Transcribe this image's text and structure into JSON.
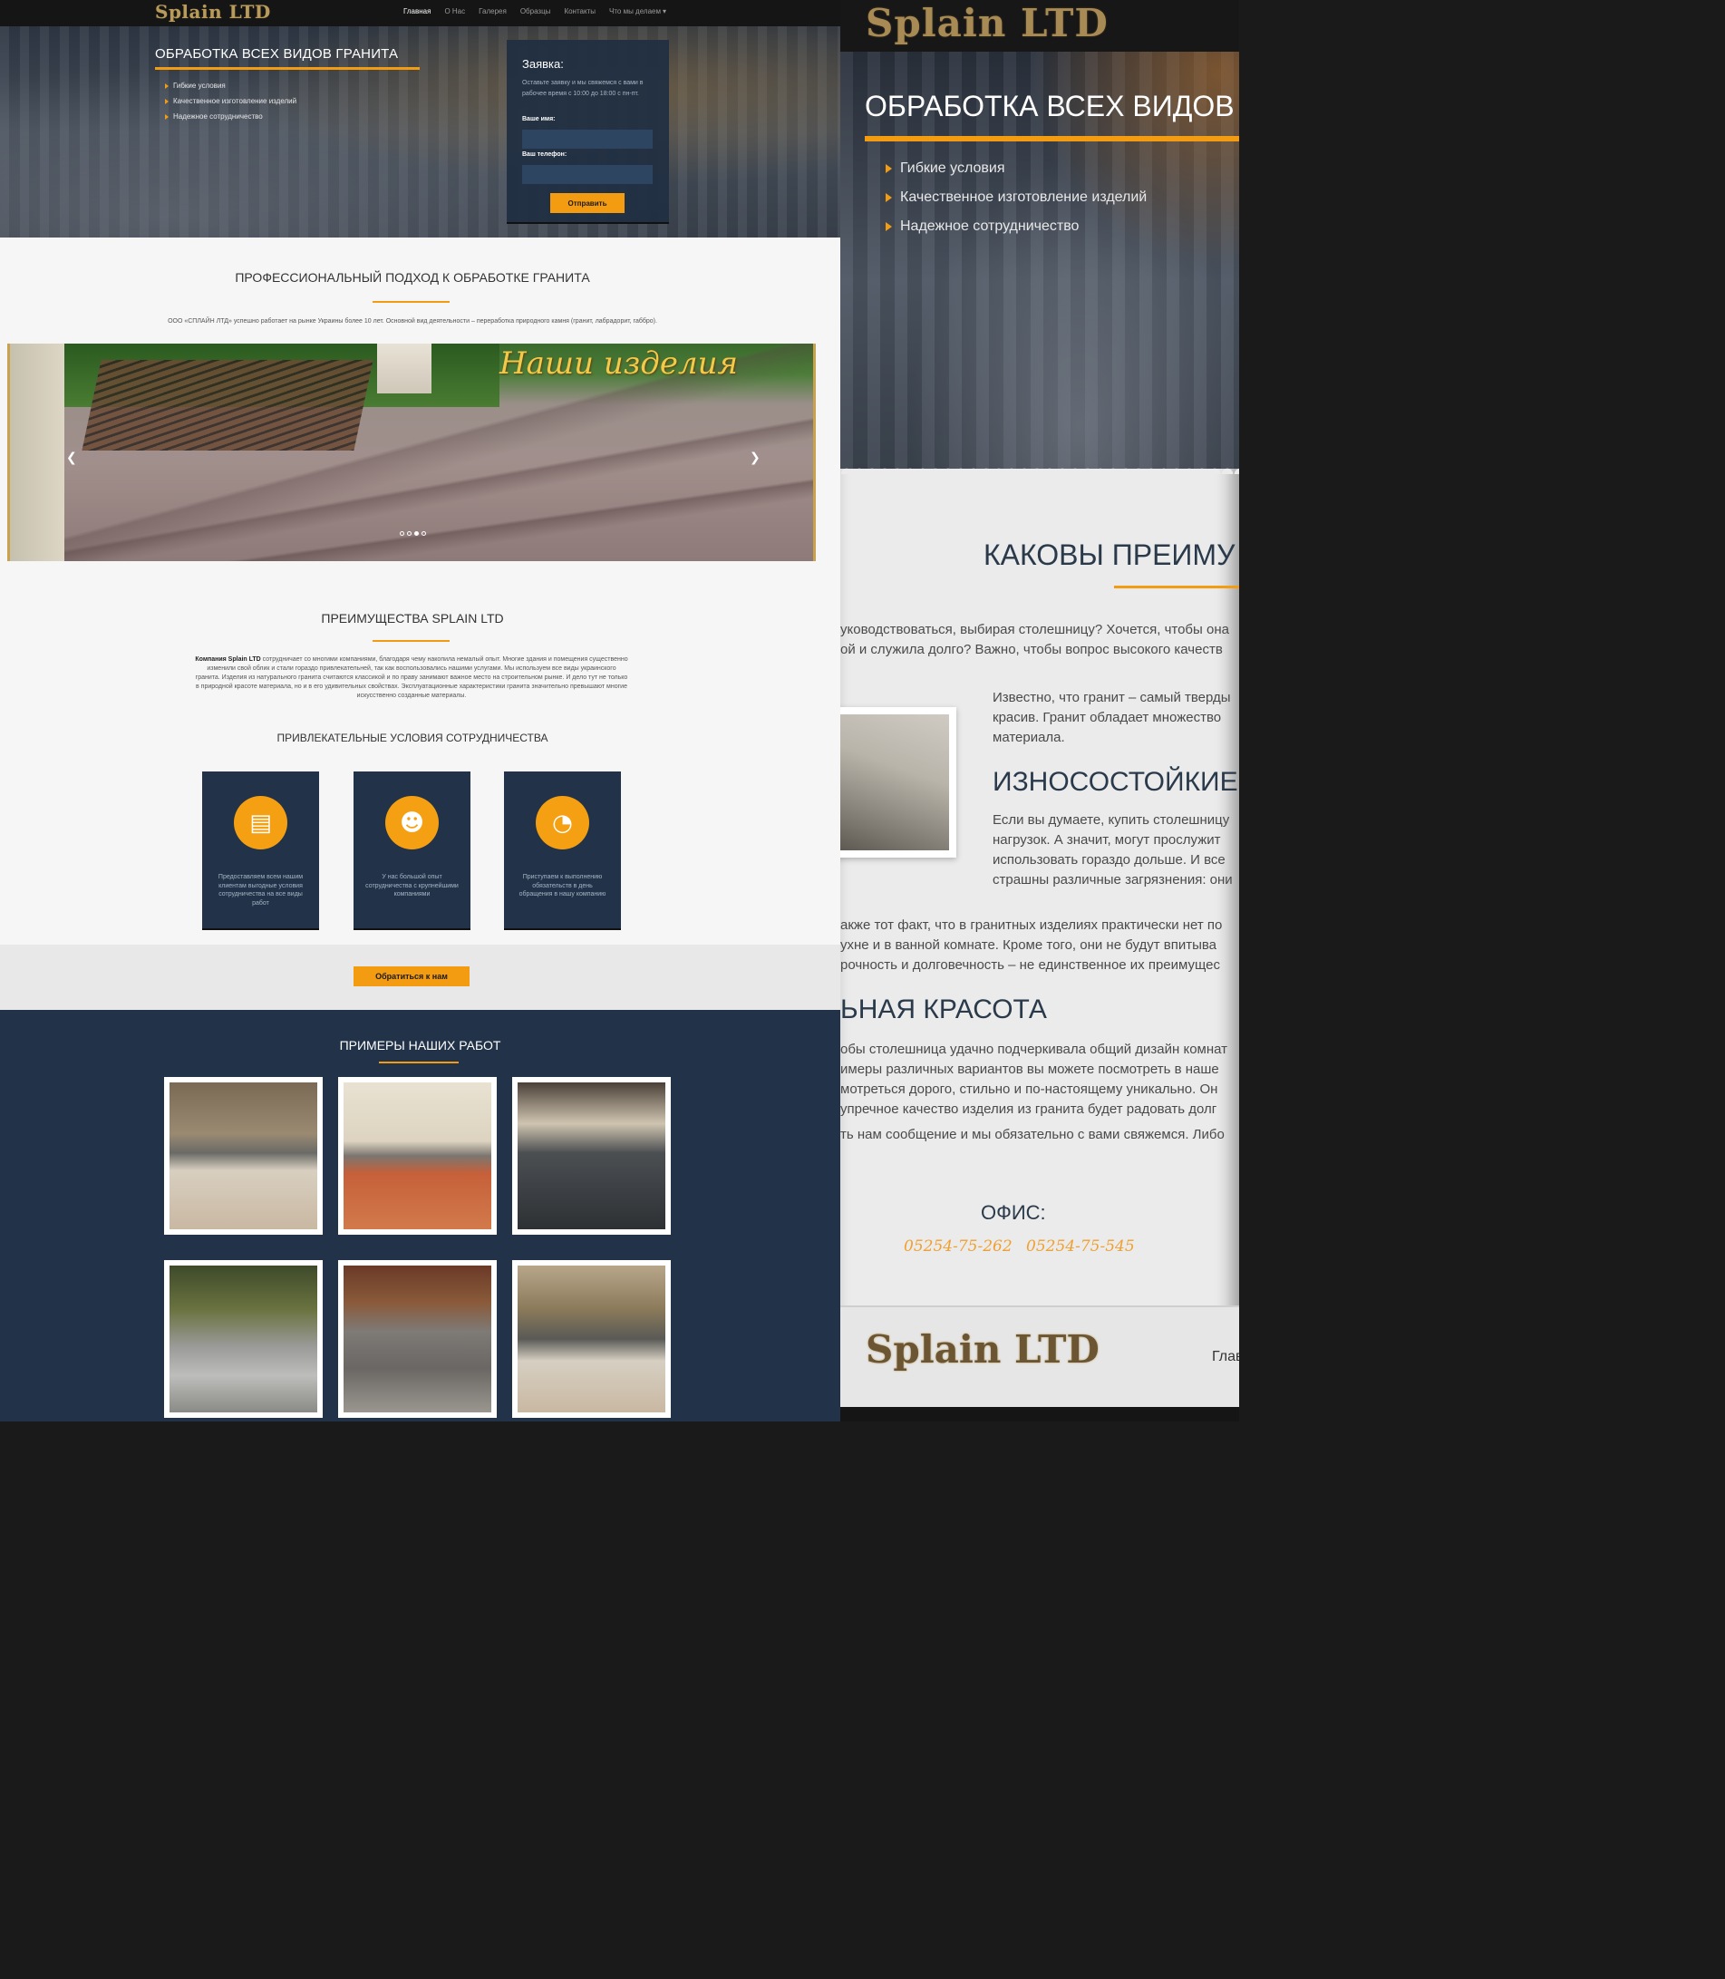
{
  "nav": {
    "logo": "Splain LTD",
    "links": [
      "Главная",
      "О Нас",
      "Галерея",
      "Образцы",
      "Контакты",
      "Что мы делаем"
    ]
  },
  "hero": {
    "title": "ОБРАБОТКА ВСЕХ ВИДОВ ГРАНИТА",
    "features": [
      "Гибкие условия",
      "Качественное изготовление изделий",
      "Надежное сотрудничество"
    ]
  },
  "form": {
    "title": "Заявка:",
    "description": "Оставьте заявку и мы свяжемся с вами в рабочее время с 10:00 до 18:00 с пн-пт.",
    "name_label": "Ваше имя:",
    "phone_label": "Ваш телефон:",
    "submit": "Отправить"
  },
  "about": {
    "title": "ПРОФЕССИОНАЛЬНЫЙ ПОДХОД К ОБРАБОТКЕ ГРАНИТА",
    "text": "ООО «СПЛАЙН ЛТД» успешно работает на рынке Украины более 10 лет. Основной вид деятельности – переработка природного камня (гранит, лабрадорит, габбро)."
  },
  "slider": {
    "caption": "Наши изделия",
    "prev_icon": "chevron-left-icon",
    "next_icon": "chevron-right-icon",
    "dots": 4,
    "active_dot": 3
  },
  "advantages": {
    "title": "ПРЕИМУЩЕСТВА SPLAIN LTD",
    "company": "Компания Splain LTD",
    "text": " сотрудничает со многими компаниями, благодаря чему накопила немалый опыт. Многие здания и помещения существенно изменили свой облик и стали гораздо привлекательней, так как воспользовались нашими услугами. Мы используем все виды украинского гранита. Изделия из натурального гранита считаются классикой и по праву занимают важное место на строительном рынке. И дело тут не только в природной красоте материала, но и в его удивительных свойствах. Эксплуатационные характеристики гранита значительно превышают многие искусственно созданные материалы.",
    "subtitle": "ПРИВЛЕКАТЕЛЬНЫЕ УСЛОВИЯ СОТРУДНИЧЕСТВА",
    "cards": [
      {
        "icon": "document-icon",
        "text": "Предоставляем всем нашим клиентам выгодные условия сотрудничества на все виды работ"
      },
      {
        "icon": "group-icon",
        "text": "У нас большой опыт сотрудничества с крупнейшими компаниями"
      },
      {
        "icon": "speedometer-icon",
        "text": "Приступаем к выполнению обязательств в день обращения в нашу компанию"
      }
    ]
  },
  "cta": {
    "button": "Обратиться к нам"
  },
  "works": {
    "title": "ПРИМЕРЫ НАШИХ РАБОТ"
  },
  "zoom": {
    "logo": "Splain LTD",
    "hero_title": "ОБРАБОТКА ВСЕХ ВИДОВ",
    "features": [
      "Гибкие условия",
      "Качественное изготовление изделий",
      "Надежное сотрудничество"
    ],
    "h2": "КАКОВЫ ПРЕИМУ",
    "para1": [
      "уководствоваться, выбирая столешницу? Хочется, чтобы она",
      "ой и служила долго? Важно, чтобы вопрос высокого качеств"
    ],
    "para2": [
      "Известно, что гранит – самый тверды",
      "красив. Гранит обладает множество",
      "материала."
    ],
    "h3a": "ИЗНОСОСТОЙКИЕ",
    "para3": [
      "Если вы думаете, купить столешницу",
      "нагрузок. А значит, могут прослужит",
      "использовать гораздо дольше. И все",
      "страшны различные загрязнения: они"
    ],
    "para4": [
      "акже тот факт, что в гранитных изделиях практически нет по",
      "ухне и в ванной комнате. Кроме того, они не будут впитыва",
      "рочность и долговечность – не единственное их преимущес"
    ],
    "h3b": "ЬНАЯ КРАСОТА",
    "para5": [
      "обы столешница удачно подчеркивала общий дизайн комнат",
      "имеры различных вариантов вы можете посмотреть в наше",
      "мотреться дорого, стильно и по-настоящему уникально. Он",
      "упречное качество изделия из гранита будет радовать долг"
    ],
    "para6": "ть нам сообщение и мы обязательно с вами свяжемся. Либо",
    "office": "ОФИС:",
    "phone1": "05254-75-262",
    "phone2": "05254-75-545",
    "footer_logo": "Splain LTD",
    "footer_link": "Глав"
  },
  "colors": {
    "accent": "#f39c12",
    "navy": "#223349",
    "dark": "#151515"
  }
}
